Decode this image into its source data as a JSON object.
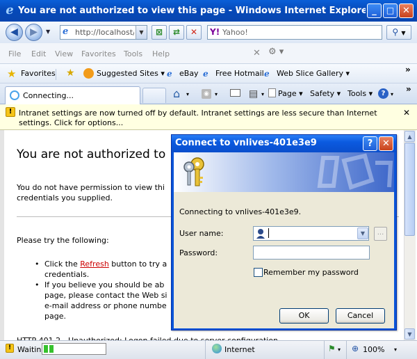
{
  "window": {
    "title": "You are not authorized to view this page - Windows Internet Explorer provide...",
    "minimize": "_",
    "maximize": "□",
    "close": "✕"
  },
  "nav": {
    "address": "http://localhost/l",
    "search_placeholder": "Yahoo!",
    "search_logo": "Y!"
  },
  "menu": [
    "File",
    "Edit",
    "View",
    "Favorites",
    "Tools",
    "Help"
  ],
  "favorites_bar": {
    "favorites_label": "Favorites",
    "items": [
      "Suggested Sites ▾",
      "eBay",
      "Free Hotmail",
      "Web Slice Gallery ▾"
    ]
  },
  "tab": {
    "label": "Connecting...",
    "commands": [
      "Page ▾",
      "Safety ▾",
      "Tools ▾"
    ]
  },
  "infobar": {
    "text": "Intranet settings are now turned off by default. Intranet settings are less secure than Internet settings. Click for options..."
  },
  "page": {
    "title": "You are not authorized to",
    "para1_line1": "You do not have permission to view thi",
    "para1_line2": "credentials you supplied.",
    "try": "Please try the following:",
    "bullet1_pre": "Click the ",
    "bullet1_link": "Refresh",
    "bullet1_post": " button to try a",
    "bullet1_line2": "credentials.",
    "bullet2_line1": "If you believe you should be ab",
    "bullet2_line2": "page, please contact the Web si",
    "bullet2_line3": "e-mail address or phone numbe",
    "bullet2_line4": "page.",
    "footer": "HTTP 401.2 - Unauthorized: Logon failed due to server configuration"
  },
  "status": {
    "text": "Waitin",
    "progress": 0.15,
    "zone": "Internet",
    "zoom": "100%"
  },
  "dialog": {
    "title": "Connect to vnlives-401e3e9",
    "help": "?",
    "close": "✕",
    "message": "Connecting to vnlives-401e3e9.",
    "username_label": "User name:",
    "password_label": "Password:",
    "username_value": "",
    "remember_label": "Remember my password",
    "ok": "OK",
    "cancel": "Cancel",
    "browse": "..."
  }
}
